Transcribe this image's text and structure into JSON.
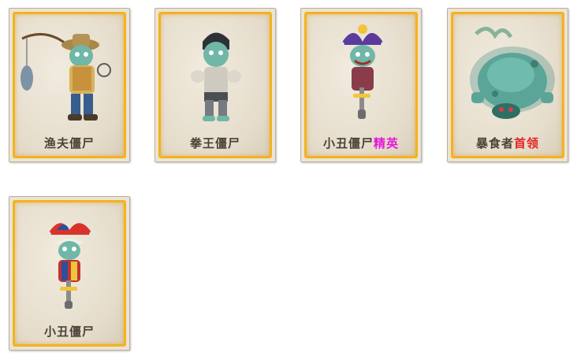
{
  "cards": [
    {
      "name": "渔夫僵尸",
      "tag": "",
      "icon": "fisherman-zombie-icon"
    },
    {
      "name": "拳王僵尸",
      "tag": "",
      "icon": "boxer-zombie-icon"
    },
    {
      "name": "小丑僵尸",
      "tag": "精英",
      "tag_color": "#e619d9",
      "icon": "jester-zombie-icon"
    },
    {
      "name": "暴食者",
      "tag": "首领",
      "tag_color": "#e52222",
      "icon": "glutton-zombie-icon"
    },
    {
      "name": "小丑僵尸",
      "tag": "",
      "icon": "clown-zombie-icon"
    }
  ]
}
